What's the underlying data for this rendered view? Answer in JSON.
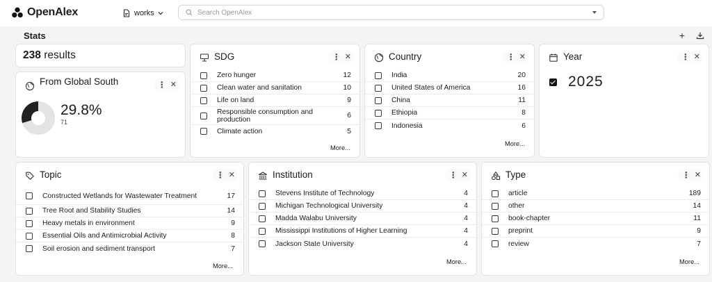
{
  "app": {
    "name": "OpenAlex"
  },
  "header": {
    "entity": "works",
    "search_placeholder": "Search OpenAlex"
  },
  "stats": {
    "title": "Stats",
    "add_symbol": "+"
  },
  "card_actions": {
    "menu": "⋮",
    "close": "✕"
  },
  "results": {
    "count": "238",
    "label": "results"
  },
  "global_south": {
    "title": "From Global South",
    "percent": "29.8%",
    "count": "71",
    "fraction": 0.298
  },
  "sdg": {
    "title": "SDG",
    "items": [
      {
        "label": "Zero hunger",
        "count": "12"
      },
      {
        "label": "Clean water and sanitation",
        "count": "10"
      },
      {
        "label": "Life on land",
        "count": "9"
      },
      {
        "label": "Responsible consumption and production",
        "count": "6"
      },
      {
        "label": "Climate action",
        "count": "5"
      }
    ],
    "more": "More..."
  },
  "country": {
    "title": "Country",
    "items": [
      {
        "label": "India",
        "count": "20"
      },
      {
        "label": "United States of America",
        "count": "16"
      },
      {
        "label": "China",
        "count": "11"
      },
      {
        "label": "Ethiopia",
        "count": "8"
      },
      {
        "label": "Indonesia",
        "count": "6"
      }
    ],
    "more": "More..."
  },
  "year": {
    "title": "Year",
    "selected": "2025"
  },
  "topic": {
    "title": "Topic",
    "items": [
      {
        "label": "Constructed Wetlands for Wastewater Treatment",
        "count": "17"
      },
      {
        "label": "Tree Root and Stability Studies",
        "count": "14"
      },
      {
        "label": "Heavy metals in environment",
        "count": "9"
      },
      {
        "label": "Essential Oils and Antimicrobial Activity",
        "count": "8"
      },
      {
        "label": "Soil erosion and sediment transport",
        "count": "7"
      }
    ],
    "more": "More..."
  },
  "institution": {
    "title": "Institution",
    "items": [
      {
        "label": "Stevens Institute of Technology",
        "count": "4"
      },
      {
        "label": "Michigan Technological University",
        "count": "4"
      },
      {
        "label": "Madda Walabu University",
        "count": "4"
      },
      {
        "label": "Mississippi Institutions of Higher Learning",
        "count": "4"
      },
      {
        "label": "Jackson State University",
        "count": "4"
      }
    ],
    "more": "More..."
  },
  "type": {
    "title": "Type",
    "items": [
      {
        "label": "article",
        "count": "189"
      },
      {
        "label": "other",
        "count": "14"
      },
      {
        "label": "book-chapter",
        "count": "11"
      },
      {
        "label": "preprint",
        "count": "9"
      },
      {
        "label": "review",
        "count": "7"
      }
    ],
    "more": "More..."
  }
}
